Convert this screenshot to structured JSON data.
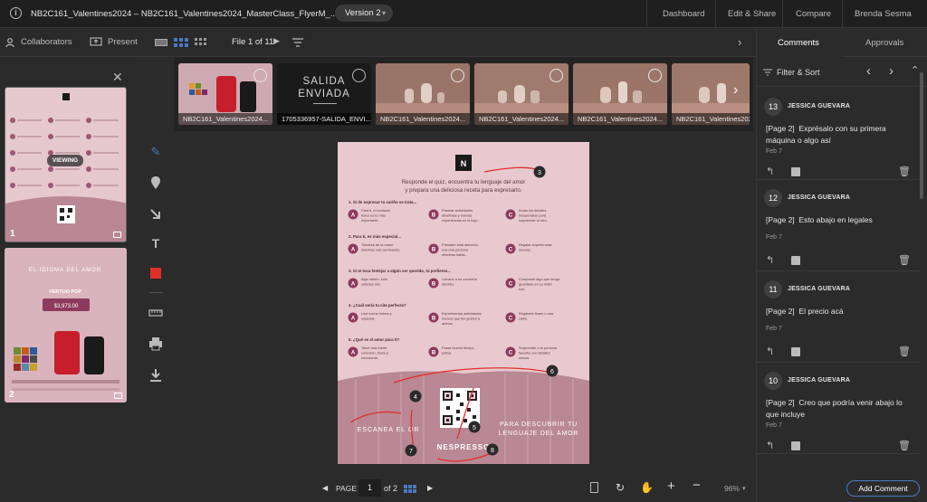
{
  "window": {
    "title": "NB2C161_Valentines2024  –  NB2C161_Valentines2024_MasterClass_FlyerM_...",
    "version_label": "Version 2",
    "nav": [
      "Dashboard",
      "Edit & Share",
      "Compare"
    ],
    "user": "Brenda Sesma"
  },
  "toolbar": {
    "collaborators": "Collaborators",
    "present": "Present",
    "file_counter": "File 1 of 11"
  },
  "left_panel": {
    "viewing_badge": "VIEWING",
    "pages": [
      {
        "number": "1"
      },
      {
        "number": "2"
      }
    ],
    "page2_text": {
      "headline": "EL IDIOMA DEL AMOR",
      "product": "VERTUO POP",
      "price": "$3,973.00"
    }
  },
  "file_strip": {
    "files": [
      {
        "label": "NB2C161_Valentines2024...",
        "status": "approved"
      },
      {
        "label": "1705336957-SALIDA_ENVI...",
        "status": "pending",
        "big_text": [
          "SALIDA",
          "ENVIADA"
        ]
      },
      {
        "label": "NB2C161_Valentines2024...",
        "status": "approved"
      },
      {
        "label": "NB2C161_Valentines2024...",
        "status": "approved"
      },
      {
        "label": "NB2C161_Valentines2024...",
        "status": "approved"
      },
      {
        "label": "NB2C161_Valentines2024...",
        "status": "approved"
      }
    ]
  },
  "document": {
    "intro_line1": "Responde el quiz, encuentra tu lenguaje del amor",
    "intro_line2": "y prepara una deliciosa receta para expresarlo.",
    "questions": [
      {
        "q": "1. Si de expresar tu cariño se trata...",
        "a": [
          "Para ti, el contacto físico es lo más importante.",
          "Planear actividades divertidas y nuevas experiencias es lo tuyo.",
          "Amas los detalles inesperados para sorprender al otro."
        ]
      },
      {
        "q": "2. Para ti, es más especial...",
        "a": [
          "Tomarse de la mano mientras van caminando.",
          "Prestarle total atención a la otra persona mientras habla.",
          "Regalar experiencias nuevas."
        ]
      },
      {
        "q": "3. Si te toca festejar a algún ser querido, tú prefieres...",
        "a": [
          "Algo íntimo, solo ustedes dos.",
          "Llevarlo a su concierto favorito.",
          "Comprarle algo que tenga guardado en su Wish List."
        ]
      },
      {
        "q": "4. ¿Cuál sería tu cita perfecta?",
        "a": [
          "Una noche íntima y especial.",
          "Experimentar actividades nuevas que les gusten a ambos.",
          "Regalarle flores o una carta."
        ]
      },
      {
        "q": "5. ¿Qué es el amor para ti?",
        "a": [
          "Tener una fuerte conexión, física y emocional.",
          "Pasar mucho tiempo juntos.",
          "Sorprender a tu persona favorita con detalles únicos."
        ]
      }
    ],
    "option_letters": [
      "A",
      "B",
      "C"
    ],
    "cta_left": "ESCANEA EL QR",
    "cta_right": [
      "PARA DESCUBRIR TU",
      "LENGUAJE DEL AMOR"
    ],
    "brand": "NESPRESSO",
    "markers": [
      "3",
      "4",
      "5",
      "6",
      "7",
      "8"
    ]
  },
  "pagination": {
    "page_label": "PAGE",
    "page_value": "1",
    "of_label": "of 2",
    "zoom": "96%"
  },
  "comments_panel": {
    "tabs": [
      "Comments",
      "Approvals"
    ],
    "filter_label": "Filter & Sort",
    "add_button": "Add Comment",
    "comments": [
      {
        "number": "13",
        "author": "JESSICA GUEVARA",
        "page": "[Page 2]",
        "text": "Exprésalo con su primera máquina o algo así",
        "date": "Feb 7"
      },
      {
        "number": "12",
        "author": "JESSICA GUEVARA",
        "page": "[Page 2]",
        "text": "Esto abajo en legales",
        "date": "Feb 7"
      },
      {
        "number": "11",
        "author": "JESSICA GUEVARA",
        "page": "[Page 2]",
        "text": "El precio acá",
        "date": "Feb 7"
      },
      {
        "number": "10",
        "author": "JESSICA GUEVARA",
        "page": "[Page 2]",
        "text": "Creo que podría venir abajo lo que incluye",
        "date": "Feb 7"
      }
    ]
  },
  "colors": {
    "background": "#2b2b2b",
    "topbar": "#1f1f1f",
    "page_pink": "#e8c9d0",
    "quiz_purple": "#8e3a5e",
    "marker_red": "#e0302a",
    "accent_blue": "#4a7ac2"
  }
}
